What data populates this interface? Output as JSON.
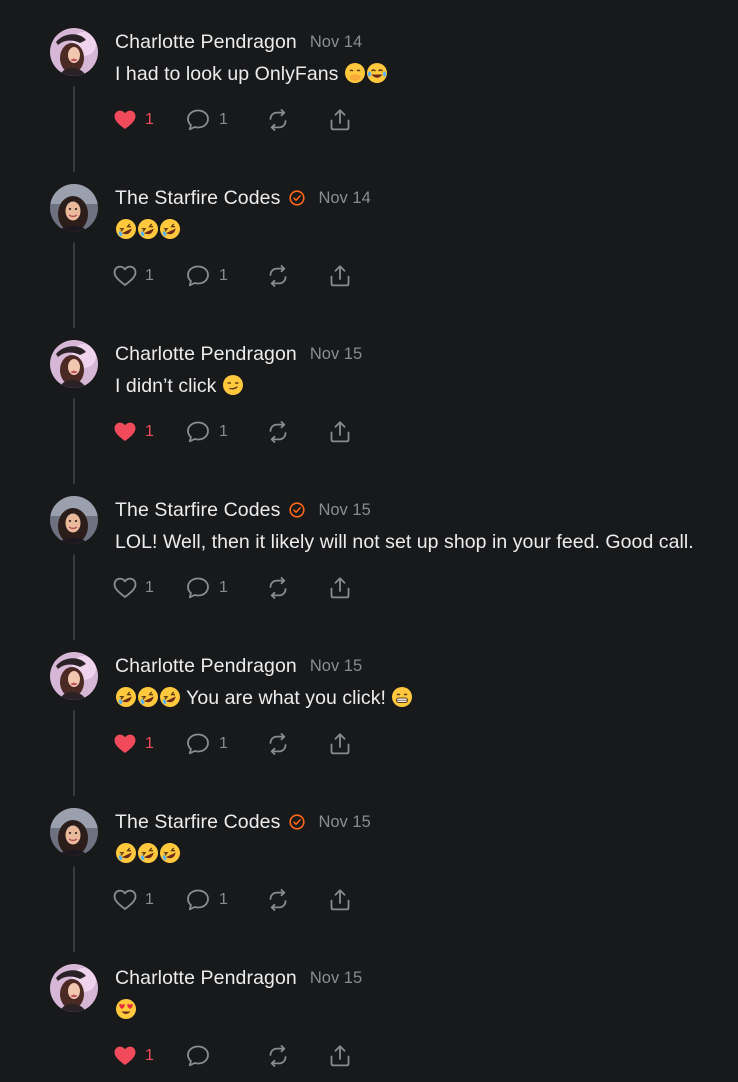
{
  "comments": [
    {
      "author": "Charlotte Pendragon",
      "verified": false,
      "date": "Nov 14",
      "text": "I had to look up OnlyFans",
      "emojis_after": [
        "hand-over-mouth",
        "tears-of-joy"
      ],
      "emojis_before": [],
      "likes": "1",
      "liked": true,
      "replies": "1",
      "thread_line": true
    },
    {
      "author": "The Starfire Codes",
      "verified": true,
      "date": "Nov 14",
      "text": "",
      "emojis_before": [
        "rofl",
        "rofl",
        "rofl"
      ],
      "emojis_after": [],
      "likes": "1",
      "liked": false,
      "replies": "1",
      "thread_line": true
    },
    {
      "author": "Charlotte Pendragon",
      "verified": false,
      "date": "Nov 15",
      "text": "I didn’t click",
      "emojis_after": [
        "smirk"
      ],
      "emojis_before": [],
      "likes": "1",
      "liked": true,
      "replies": "1",
      "thread_line": true
    },
    {
      "author": "The Starfire Codes",
      "verified": true,
      "date": "Nov 15",
      "text": "LOL! Well, then it likely will not set up shop in your feed. Good call.",
      "emojis_before": [],
      "emojis_after": [],
      "likes": "1",
      "liked": false,
      "replies": "1",
      "thread_line": true
    },
    {
      "author": "Charlotte Pendragon",
      "verified": false,
      "date": "Nov 15",
      "text": "You are what you click!",
      "emojis_before": [
        "rofl",
        "rofl",
        "rofl"
      ],
      "emojis_after": [
        "grin"
      ],
      "likes": "1",
      "liked": true,
      "replies": "1",
      "thread_line": true
    },
    {
      "author": "The Starfire Codes",
      "verified": true,
      "date": "Nov 15",
      "text": "",
      "emojis_before": [
        "rofl",
        "rofl",
        "rofl"
      ],
      "emojis_after": [],
      "likes": "1",
      "liked": false,
      "replies": "1",
      "thread_line": true
    },
    {
      "author": "Charlotte Pendragon",
      "verified": false,
      "date": "Nov 15",
      "text": "",
      "emojis_before": [
        "heart-eyes"
      ],
      "emojis_after": [],
      "likes": "1",
      "liked": true,
      "replies": "",
      "thread_line": false
    }
  ],
  "icons": {
    "like": "heart-icon",
    "reply": "comment-bubble-icon",
    "restack": "restack-icon",
    "share": "share-icon",
    "verified": "verified-badge-icon"
  },
  "colors": {
    "background": "#18191b",
    "liked": "#f04a5b",
    "muted": "#8b8c90",
    "verified": "#ff6719"
  }
}
